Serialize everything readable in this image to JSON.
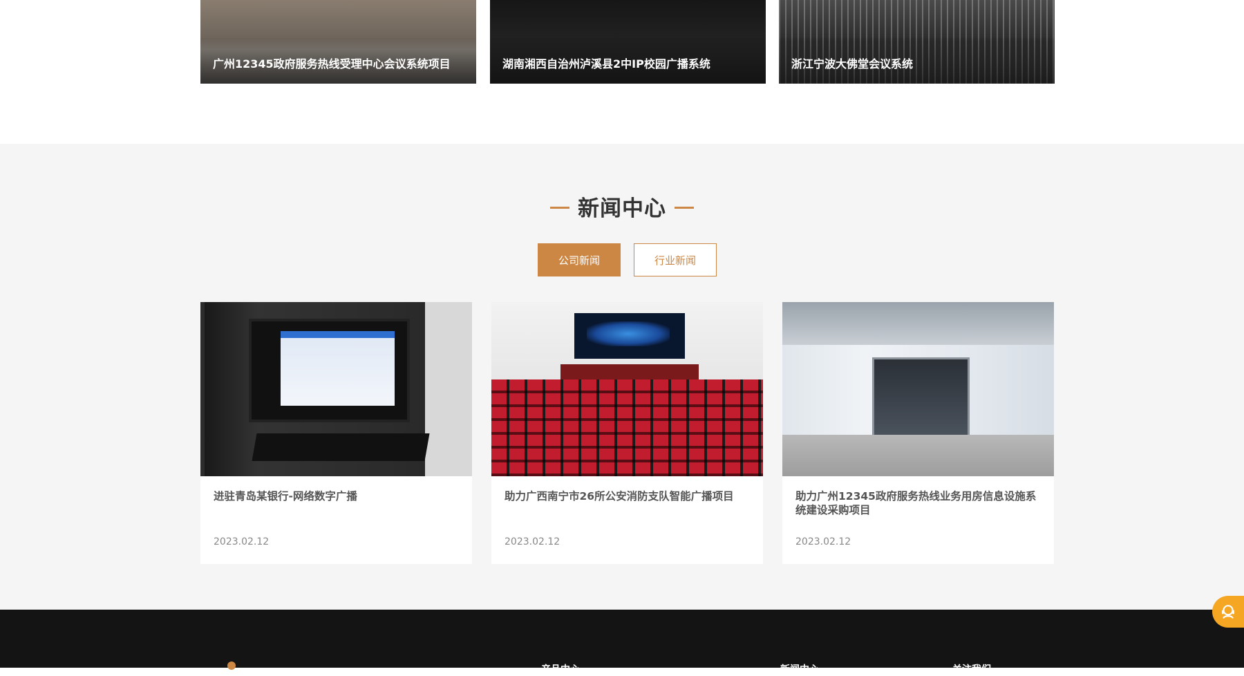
{
  "projects": [
    {
      "title": "广州12345政府服务热线受理中心会议系统项目"
    },
    {
      "title": "湖南湘西自治州泸溪县2中IP校园广播系统"
    },
    {
      "title": "浙江宁波大佛堂会议系统"
    }
  ],
  "news": {
    "title": "新闻中心",
    "tabs": [
      {
        "label": "公司新闻",
        "active": true
      },
      {
        "label": "行业新闻",
        "active": false
      }
    ],
    "items": [
      {
        "title": "进驻青岛某银行-网络数字广播",
        "date": "2023.02.12"
      },
      {
        "title": "助力广西南宁市26所公安消防支队智能广播项目",
        "date": "2023.02.12"
      },
      {
        "title": "助力广州12345政府服务热线业务用房信息设施系统建设采购项目",
        "date": "2023.02.12"
      }
    ]
  },
  "footer": {
    "cols": [
      "产品中心",
      "新闻中心",
      "关注我们"
    ]
  },
  "colors": {
    "accent": "#cd8744",
    "news_bg": "#f5f5f5",
    "footer_bg": "#141414",
    "float_btn": "#f5a623"
  }
}
